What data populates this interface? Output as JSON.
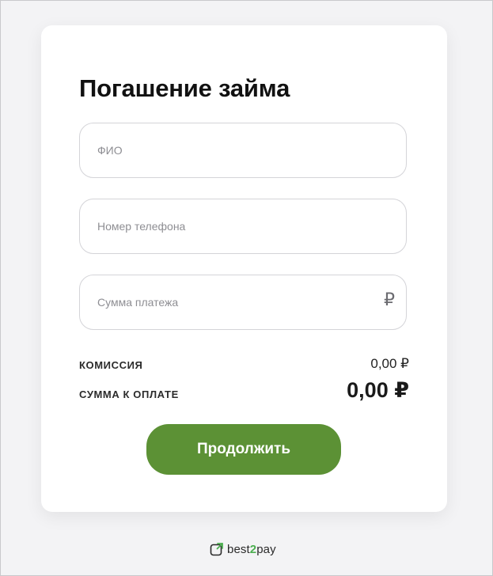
{
  "form": {
    "title": "Погашение займа",
    "fields": [
      {
        "placeholder": "ФИО",
        "value": ""
      },
      {
        "placeholder": "Номер телефона",
        "value": ""
      },
      {
        "placeholder": "Сумма платежа",
        "value": ""
      }
    ],
    "currency_symbol": "₽",
    "commission": {
      "label": "КОМИССИЯ",
      "value": "0,00 ₽"
    },
    "total": {
      "label": "СУММА К ОПЛАТЕ",
      "value": "0,00 ₽"
    },
    "submit_label": "Продолжить"
  },
  "footer": {
    "brand_prefix": "best",
    "brand_accent": "2",
    "brand_suffix": "pay"
  },
  "colors": {
    "accent": "#5c9135",
    "background": "#f3f3f5",
    "card": "#ffffff"
  }
}
